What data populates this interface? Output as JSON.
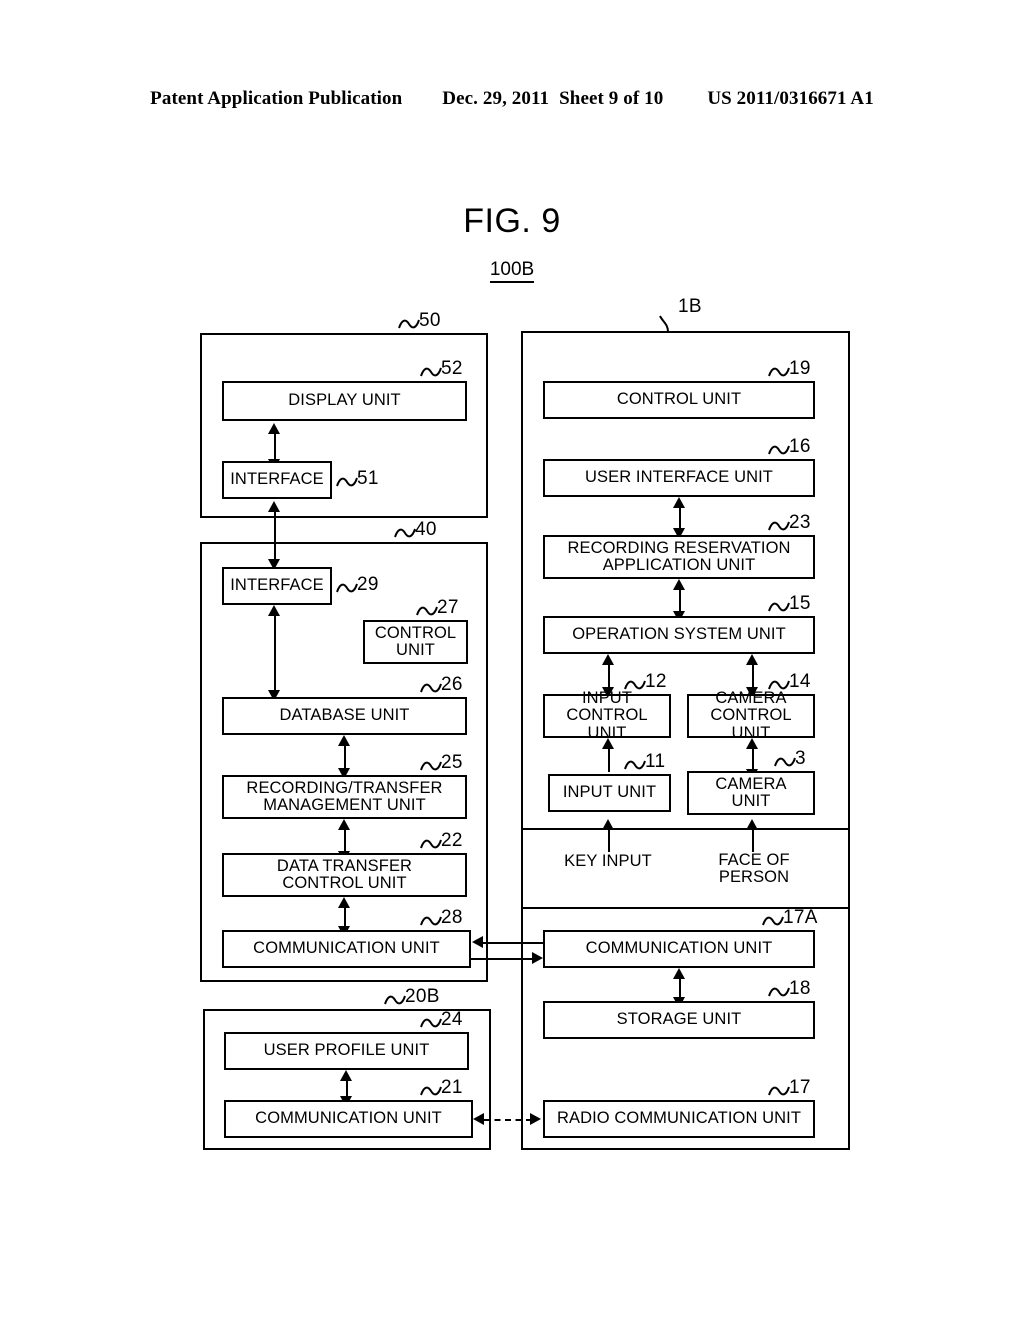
{
  "header": {
    "publication": "Patent Application Publication",
    "date": "Dec. 29, 2011",
    "sheet": "Sheet 9 of 10",
    "patent_number": "US 2011/0316671 A1"
  },
  "figure": {
    "title": "FIG. 9",
    "system_label": "100B"
  },
  "containers": {
    "display_device": {
      "ref": "50"
    },
    "server_device": {
      "ref": "40"
    },
    "profile_device": {
      "ref": "20B"
    },
    "terminal_device": {
      "ref": "1B"
    }
  },
  "blocks": {
    "display_unit": {
      "label": "DISPLAY UNIT",
      "ref": "52"
    },
    "interface_51": {
      "label": "INTERFACE",
      "ref": "51"
    },
    "interface_29": {
      "label": "INTERFACE",
      "ref": "29"
    },
    "control_unit_27": {
      "label": "CONTROL\nUNIT",
      "line1": "CONTROL",
      "line2": "UNIT",
      "ref": "27"
    },
    "database_unit": {
      "label": "DATABASE UNIT",
      "ref": "26"
    },
    "recording_transfer_management_unit": {
      "line1": "RECORDING/TRANSFER",
      "line2": "MANAGEMENT UNIT",
      "ref": "25"
    },
    "data_transfer_control_unit": {
      "line1": "DATA TRANSFER",
      "line2": "CONTROL UNIT",
      "ref": "22"
    },
    "communication_unit_28": {
      "label": "COMMUNICATION UNIT",
      "ref": "28"
    },
    "user_profile_unit": {
      "label": "USER PROFILE UNIT",
      "ref": "24"
    },
    "communication_unit_21": {
      "label": "COMMUNICATION UNIT",
      "ref": "21"
    },
    "control_unit_19": {
      "label": "CONTROL UNIT",
      "ref": "19"
    },
    "user_interface_unit": {
      "label": "USER INTERFACE UNIT",
      "ref": "16"
    },
    "recording_reservation_application_unit": {
      "line1": "RECORDING RESERVATION",
      "line2": "APPLICATION UNIT",
      "ref": "23"
    },
    "operation_system_unit": {
      "label": "OPERATION SYSTEM UNIT",
      "ref": "15"
    },
    "input_control_unit": {
      "line1": "INPUT",
      "line2": "CONTROL UNIT",
      "ref": "12"
    },
    "camera_control_unit": {
      "line1": "CAMERA",
      "line2": "CONTROL UNIT",
      "ref": "14"
    },
    "input_unit": {
      "label": "INPUT UNIT",
      "ref": "11"
    },
    "camera_unit": {
      "line1": "CAMERA",
      "line2": "UNIT",
      "ref": "3"
    },
    "communication_unit_17a": {
      "label": "COMMUNICATION UNIT",
      "ref": "17A"
    },
    "storage_unit": {
      "label": "STORAGE UNIT",
      "ref": "18"
    },
    "radio_communication_unit": {
      "label": "RADIO COMMUNICATION UNIT",
      "ref": "17"
    }
  },
  "annotations": {
    "key_input": "KEY INPUT",
    "face_of_person": {
      "line1": "FACE OF",
      "line2": "PERSON"
    }
  }
}
